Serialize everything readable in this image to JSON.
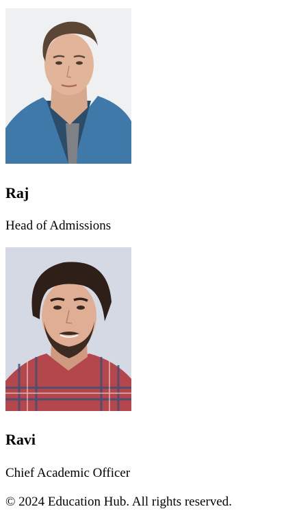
{
  "team": [
    {
      "name": "Raj",
      "role": "Head of Admissions",
      "photo_icon": "person-photo-denim-shirt"
    },
    {
      "name": "Ravi",
      "role": "Chief Academic Officer",
      "photo_icon": "person-photo-plaid-shirt"
    }
  ],
  "footer": {
    "text": "© 2024 Education Hub. All rights reserved."
  }
}
